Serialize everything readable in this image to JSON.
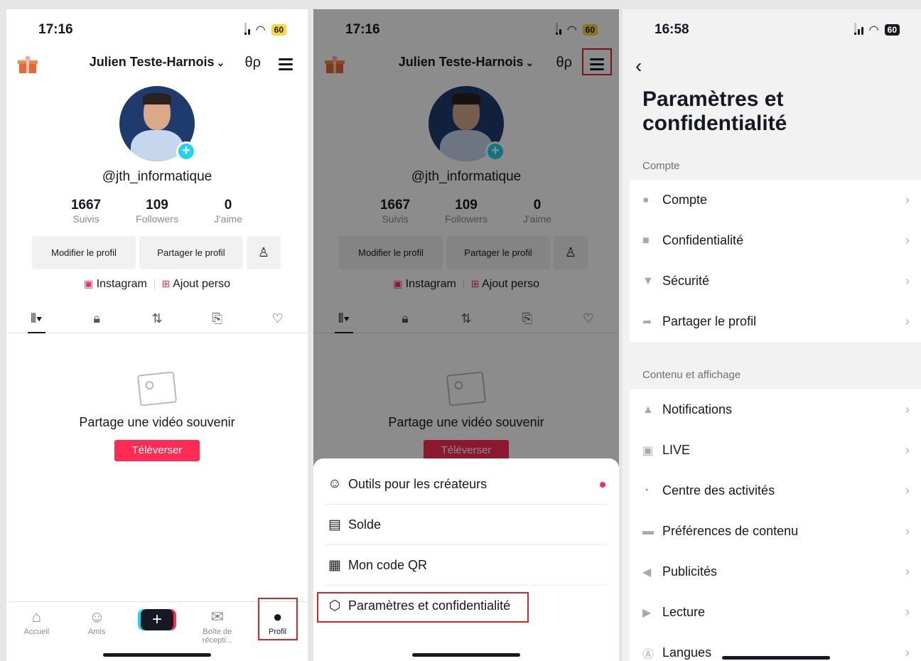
{
  "panel1": {
    "status": {
      "time": "17:16",
      "battery": "60"
    },
    "header": {
      "username": "Julien Teste-Harnois",
      "username_chevron": "⌄",
      "footprint_icon": "footprint-icon"
    },
    "profile": {
      "handle": "@jth_informatique",
      "stats": [
        {
          "value": "1667",
          "label": "Suivis"
        },
        {
          "value": "109",
          "label": "Followers"
        },
        {
          "value": "0",
          "label": "J'aime"
        }
      ],
      "buttons": {
        "edit": "Modifier le profil",
        "share": "Partager le profil"
      },
      "links": {
        "instagram": "Instagram",
        "custom": "Ajout perso"
      }
    },
    "empty": {
      "title": "Partage une vidéo souvenir",
      "upload": "Téléverser"
    },
    "nav": [
      {
        "label": "Accueil",
        "icon": "⌂"
      },
      {
        "label": "Amis",
        "icon": "👥"
      },
      {
        "label": "",
        "icon": "+"
      },
      {
        "label": "Boîte de récepti...",
        "icon": "✉"
      },
      {
        "label": "Profil",
        "icon": "👤"
      }
    ]
  },
  "panel2": {
    "status": {
      "time": "17:16",
      "battery": "60"
    },
    "header": {
      "username": "Julien Teste-Harnois"
    },
    "profile": {
      "handle": "@jth_informatique",
      "stats": [
        {
          "value": "1667",
          "label": "Suivis"
        },
        {
          "value": "109",
          "label": "Followers"
        },
        {
          "value": "0",
          "label": "J'aime"
        }
      ],
      "buttons": {
        "edit": "Modifier le profil",
        "share": "Partager le profil"
      },
      "links": {
        "instagram": "Instagram",
        "custom": "Ajout perso"
      }
    },
    "empty": {
      "title": "Partage une vidéo souvenir",
      "upload": "Téléverser"
    },
    "sheet": [
      {
        "label": "Outils pour les créateurs",
        "icon": "person-star-icon"
      },
      {
        "label": "Solde",
        "icon": "wallet-icon"
      },
      {
        "label": "Mon code QR",
        "icon": "qr-code-icon"
      },
      {
        "label": "Paramètres et confidentialité",
        "icon": "settings-icon"
      }
    ]
  },
  "panel3": {
    "status": {
      "time": "16:58",
      "battery": "60"
    },
    "title": "Paramètres et confidentialité",
    "sections": [
      {
        "label": "Compte",
        "items": [
          {
            "label": "Compte",
            "icon": "person-icon"
          },
          {
            "label": "Confidentialité",
            "icon": "lock-icon"
          },
          {
            "label": "Sécurité",
            "icon": "shield-icon"
          },
          {
            "label": "Partager le profil",
            "icon": "share-icon"
          }
        ]
      },
      {
        "label": "Contenu et affichage",
        "items": [
          {
            "label": "Notifications",
            "icon": "bell-icon"
          },
          {
            "label": "LIVE",
            "icon": "live-icon"
          },
          {
            "label": "Centre des activités",
            "icon": "clock-icon"
          },
          {
            "label": "Préférences de contenu",
            "icon": "video-icon"
          },
          {
            "label": "Publicités",
            "icon": "megaphone-icon"
          },
          {
            "label": "Lecture",
            "icon": "play-icon"
          },
          {
            "label": "Langues",
            "icon": "language-icon"
          }
        ]
      }
    ]
  }
}
